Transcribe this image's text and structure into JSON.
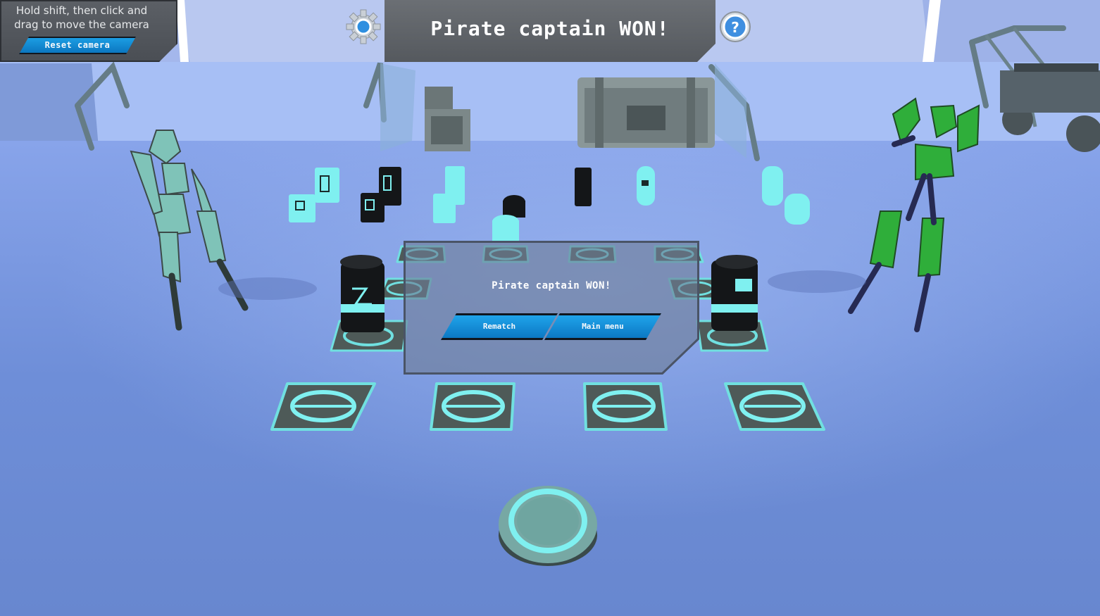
{
  "camera_panel": {
    "hint": "Hold shift, then click and\ndrag to move the camera",
    "reset_label": "Reset camera"
  },
  "header": {
    "title": "Pirate captain WON!",
    "settings_icon": "gear-icon",
    "help_icon": "question-mark-icon",
    "help_glyph": "?"
  },
  "result_dialog": {
    "title": "Pirate captain WON!",
    "rematch_label": "Rematch",
    "main_menu_label": "Main menu"
  },
  "colors": {
    "accent_blue": "#0a90d8",
    "tile_glow": "#6fe8e8",
    "floor": "#6e8fd8"
  }
}
